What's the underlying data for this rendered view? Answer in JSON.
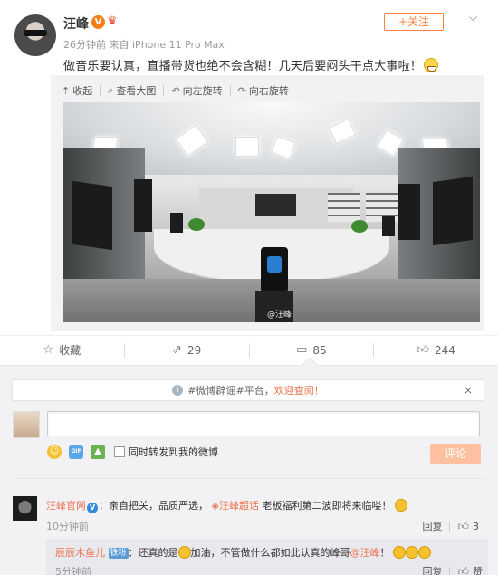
{
  "post": {
    "author": "汪峰",
    "verified_badge": "V",
    "crown_icon": "crown-icon",
    "time": "26分钟前",
    "source_prefix": "来自",
    "source": "iPhone 11 Pro Max",
    "follow_label": "+关注",
    "dropdown_icon": "chevron-down-icon",
    "text": "做音乐要认真，直播带货也绝不会含糊！几天后要闷头干点大事啦！"
  },
  "media": {
    "toolbar": [
      {
        "icon": "arrow-up-icon",
        "glyph": "⇡",
        "label": "收起"
      },
      {
        "icon": "magnifier-icon",
        "glyph": "⌕",
        "label": "查看大图"
      },
      {
        "icon": "rotate-left-icon",
        "glyph": "↶",
        "label": "向左旋转"
      },
      {
        "icon": "rotate-right-icon",
        "glyph": "↷",
        "label": "向右旋转"
      }
    ],
    "watermark": "@汪峰"
  },
  "actions": {
    "favorite": {
      "icon": "star-icon",
      "label": "收藏"
    },
    "repost": {
      "icon": "repost-icon",
      "count": "29"
    },
    "comment": {
      "icon": "comment-icon",
      "count": "85"
    },
    "like": {
      "icon": "thumbs-up-icon",
      "count": "244"
    }
  },
  "comment_box": {
    "notice_prefix": "#微博辟谣#平台，",
    "notice_link": "欢迎查阅！",
    "notice_close": "×",
    "repost_checkbox_label": "同时转发到我的微博",
    "submit_label": "评论"
  },
  "comments": [
    {
      "user": "汪峰官网",
      "verified": "V",
      "text_before_topic": "：亲自把关，品质严选，",
      "topic_icon": "◈",
      "topic": "汪峰超话",
      "text_after_topic": " 老板福利第二波即将来临喽！",
      "time": "10分钟前",
      "reply_label": "回复",
      "like_count": "3",
      "reply": {
        "user": "辰辰木鱼儿",
        "badge": "铁粉",
        "text1": "：还真的是",
        "text2": "加油，不管做什么都如此认真的峰哥",
        "mention": "@汪峰",
        "text3": "！",
        "time": "5分钟前",
        "reply_label": "回复",
        "like_label": "赞"
      }
    }
  ]
}
